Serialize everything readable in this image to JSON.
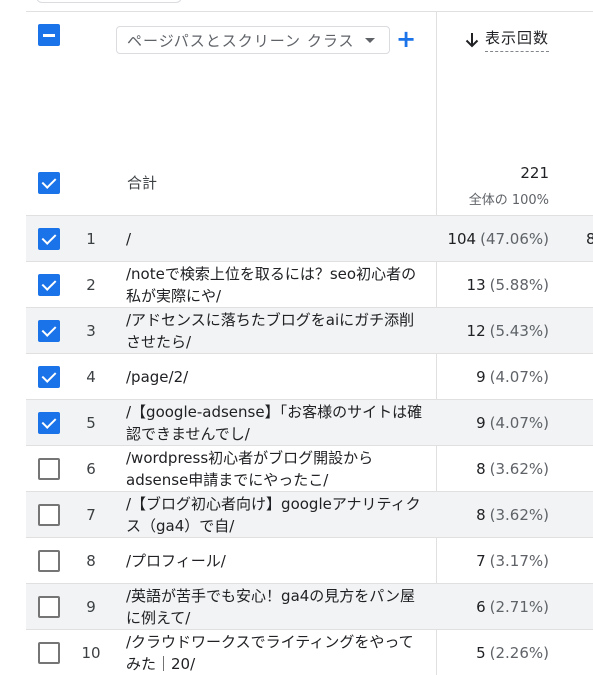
{
  "header": {
    "dimension_label": "ページパスとスクリーン クラス",
    "metric_label": "表示回数"
  },
  "totals": {
    "label": "合計",
    "value": "221",
    "pct": "全体の 100%"
  },
  "rows": [
    {
      "num": "1",
      "path": "/",
      "value": "104",
      "pct": "(47.06%)",
      "checked": true,
      "overflow": "8"
    },
    {
      "num": "2",
      "path": "/noteで検索上位を取るには？seo初心者の私が実際にや/",
      "value": "13",
      "pct": "(5.88%)",
      "checked": true,
      "overflow": ""
    },
    {
      "num": "3",
      "path": "/アドセンスに落ちたブログをaiにガチ添削させたら/",
      "value": "12",
      "pct": "(5.43%)",
      "checked": true,
      "overflow": ""
    },
    {
      "num": "4",
      "path": "/page/2/",
      "value": "9",
      "pct": "(4.07%)",
      "checked": true,
      "overflow": ""
    },
    {
      "num": "5",
      "path": "/【google-adsense】「お客様のサイトは確認できませんでし/",
      "value": "9",
      "pct": "(4.07%)",
      "checked": true,
      "overflow": ""
    },
    {
      "num": "6",
      "path": "/wordpress初心者がブログ開設からadsense申請までにやったこ/",
      "value": "8",
      "pct": "(3.62%)",
      "checked": false,
      "overflow": ""
    },
    {
      "num": "7",
      "path": "/【ブログ初心者向け】googleアナリティクス（ga4）で自/",
      "value": "8",
      "pct": "(3.62%)",
      "checked": false,
      "overflow": ""
    },
    {
      "num": "8",
      "path": "/プロフィール/",
      "value": "7",
      "pct": "(3.17%)",
      "checked": false,
      "overflow": ""
    },
    {
      "num": "9",
      "path": "/英語が苦手でも安心！ga4の見方をパン屋に例えて/",
      "value": "6",
      "pct": "(2.71%)",
      "checked": false,
      "overflow": ""
    },
    {
      "num": "10",
      "path": "/クラウドワークスでライティングをやってみた｜20/",
      "value": "5",
      "pct": "(2.26%)",
      "checked": false,
      "overflow": ""
    }
  ],
  "icons": {
    "select_all": "indeterminate-checkbox-icon",
    "dropdown": "caret-down-icon",
    "add": "plus-icon",
    "sort": "arrow-down-icon"
  },
  "colors": {
    "accent": "#1a73e8",
    "row_shade": "#f1f3f4"
  }
}
